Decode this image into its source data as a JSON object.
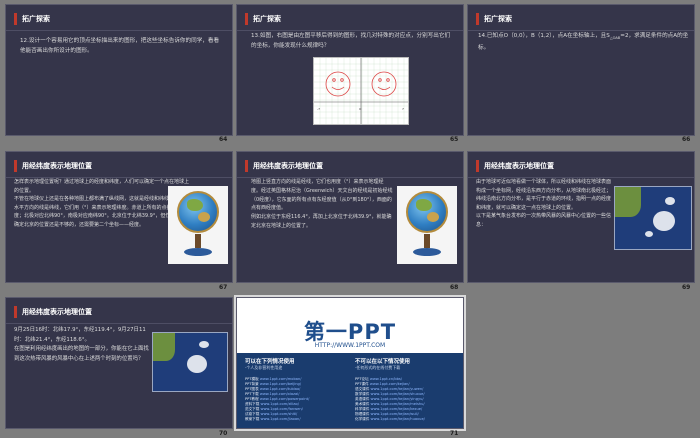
{
  "slides": [
    {
      "number": "64",
      "header": "拓广探索",
      "text": "12.设计一个容易用它的顶点坐标描出来的图形，把这些坐标告诉你的同学，看看他能否画出你所设计的图形。"
    },
    {
      "number": "65",
      "header": "拓广探索",
      "text": "13.如图，右图是由左图平移后得到的图形，找几对特殊的对应点，分别写出它们的坐标，你能发现什么规律吗？",
      "graph_axis_labels": [
        "-7",
        "-6",
        "-5",
        "-4",
        "-3",
        "-2",
        "-1",
        "O",
        "1",
        "2",
        "3",
        "4",
        "5",
        "6",
        "7"
      ]
    },
    {
      "number": "66",
      "header": "拓广探索",
      "text": "14.已知点O（0,0），B（1,2），点A在坐标轴上，且S",
      "text_sub": "△OAB",
      "text_after": "=2，求满足条件的点A的坐标。"
    },
    {
      "number": "67",
      "header": "用经纬度表示地理位置",
      "text": "怎样表示地理位置呢？通过地球上的经度和纬度，人们可以确定一个点在地球上的位置。\n不管在地球仪上还是在各种地图上都布满了纵线网，这就是经线和纬线，地图上水平方向的线是纬线，它们用（°）来表示地理纬度。赤道上所有的点都是0纬度；北极对应北纬90°，南极对应南纬90°。北京位于北纬39.9°，但仅用纬度确定北京的位置还是不够的，还需要第二个坐标——经度。"
    },
    {
      "number": "68",
      "header": "用经纬度表示地理位置",
      "text": "地图上竖直方向的线是经线，它们也用度（°）来表示地理经度。经过英国格林尼治（Greenwich）天文台的经线是初始经线（0经度），它东面的所有点有东经度值（从0°到180°），西面的点有西经度值。\n例如北京位于东经116.4°，再加上北京位于北纬39.9°，就能确定北京在地球上的位置了。"
    },
    {
      "number": "69",
      "header": "用经纬度表示地理位置",
      "text": "由于地球可近似地看做一个球体，所以经线和纬线在地球表面构成一个坐标网，经线沿东西方向分布，从地球南北极经过；纬线沿南北方向分布，是平行于赤道的环线，指明一点的经度和纬度，就可以确定这一点在地球上的位置。\n以下是某气象台发布的一次热带风暴的风暴中心位置的一些信息："
    },
    {
      "number": "70",
      "header": "用经纬度表示地理位置",
      "text": "9月25日16时：北纬17.9°，东经119.4°，9月27日11时：北纬21.4°，东经118.6°。\n在图是利用经纬度画出的地图的一部分，你能在它上面找到这次热带风暴的风暴中心在上述两个时刻的位置吗？"
    },
    {
      "number": "71",
      "brand": {
        "title": "第一PPT",
        "url": "HTTP://WWW.1PPT.COM",
        "left_title": "可以在下列情况使用",
        "left_sub": "·个人及非营利性用途",
        "right_title": "不可以在以下情况使用",
        "right_sub": "·任何形式的在线付费下载",
        "left_items": [
          {
            "label": "PPT模板",
            "link": "www.1ppt.com/moban/"
          },
          {
            "label": "PPT背景",
            "link": "www.1ppt.com/beijing/"
          },
          {
            "label": "PPT图表",
            "link": "www.1ppt.com/tubiao/"
          },
          {
            "label": "PPT下载",
            "link": "www.1ppt.com/xiazai/"
          },
          {
            "label": "PPT教程",
            "link": "www.1ppt.com/powerpoint/"
          },
          {
            "label": "资料下载",
            "link": "www.1ppt.com/ziliao/"
          },
          {
            "label": "范文下载",
            "link": "www.1ppt.com/fanwen/"
          },
          {
            "label": "试卷下载",
            "link": "www.1ppt.com/shiti/"
          },
          {
            "label": "教案下载",
            "link": "www.1ppt.com/jiaoan/"
          }
        ],
        "right_items": [
          {
            "label": "PPT论坛",
            "link": "www.1ppt.cn/bbs/"
          },
          {
            "label": "PPT课件",
            "link": "www.1ppt.com/kejian/"
          },
          {
            "label": "语文课件",
            "link": "www.1ppt.com/kejian/yuwen/"
          },
          {
            "label": "数学课件",
            "link": "www.1ppt.com/kejian/shuxue/"
          },
          {
            "label": "英语课件",
            "link": "www.1ppt.com/kejian/yingyu/"
          },
          {
            "label": "美术课件",
            "link": "www.1ppt.com/kejian/meishu/"
          },
          {
            "label": "科学课件",
            "link": "www.1ppt.com/kejian/kexue/"
          },
          {
            "label": "物理课件",
            "link": "www.1ppt.com/kejian/wuli/"
          },
          {
            "label": "化学课件",
            "link": "www.1ppt.com/kejian/huaxue/"
          }
        ]
      }
    }
  ],
  "colors": {
    "slide_bg": "#35354a",
    "accent": "#c0392b",
    "brand_blue": "#1f4e8c"
  }
}
